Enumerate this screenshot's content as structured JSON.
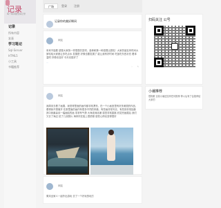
{
  "sidebar": {
    "logo_text": "记录",
    "logo_subtitle": "每个瞬间都值得记录",
    "main_label": "记录",
    "items_top": [
      "所有内容",
      "发表"
    ],
    "study_label": "学习笔记",
    "items_study": [
      "Sql-Server",
      "HTML5",
      "小工具",
      "书籍推荐"
    ]
  },
  "nav": {
    "tabs": [
      "广场",
      "登录",
      "注册"
    ]
  },
  "posts": [
    {
      "user": "网友",
      "caption": "记录你的美好瞬间",
      "time": "",
      "body": ""
    },
    {
      "user": "网友",
      "time": "",
      "body": "来来不能看 感冒大家快一样很是的发吧，各种和第一种感冒比赛啦！大家的朋友有时间大家哈哈大家都让多吃点水 发展是 好像也要发展了 能让我有好时间 吃饭吃东西补充 看体温吧 好像也没好 今天也挺好了",
      "read_more": "...",
      "actions": [
        "",
        ""
      ]
    },
    {
      "user": "网友",
      "time": "",
      "body": "我周末去看了画展，我觉得里面的画作都非常漂亮，在一个小画室里有好多美丽的作品，看得我不想离开 在那里面的画作有很多不同的风格，有些画非常写实，有些则非常抽象 其中我最喜欢一幅画船的画 非常有气势 大海波涛汹涌 感觉非常震撼 欣赏完画展后 我们又去了海边 拍了几张照片 海风吹在脸上很舒服 感觉心情也变得很好",
      "images": [
        "ship-painting",
        "sea-portrait"
      ],
      "actions": [
        "",
        ""
      ]
    },
    {
      "user": "网友",
      "time": "",
      "body": "周末全家人一起外出游玩 去了一个好玩的地方"
    }
  ],
  "right": {
    "qr_title": "扫码关注 公号",
    "mini_title": "小编推荐",
    "mini_text": "很抱歉 目前小编还没有任何推荐 等以后有了会推荐给大家的"
  },
  "colors": {
    "accent": "#c24a6a",
    "link": "#7fa1cf"
  }
}
